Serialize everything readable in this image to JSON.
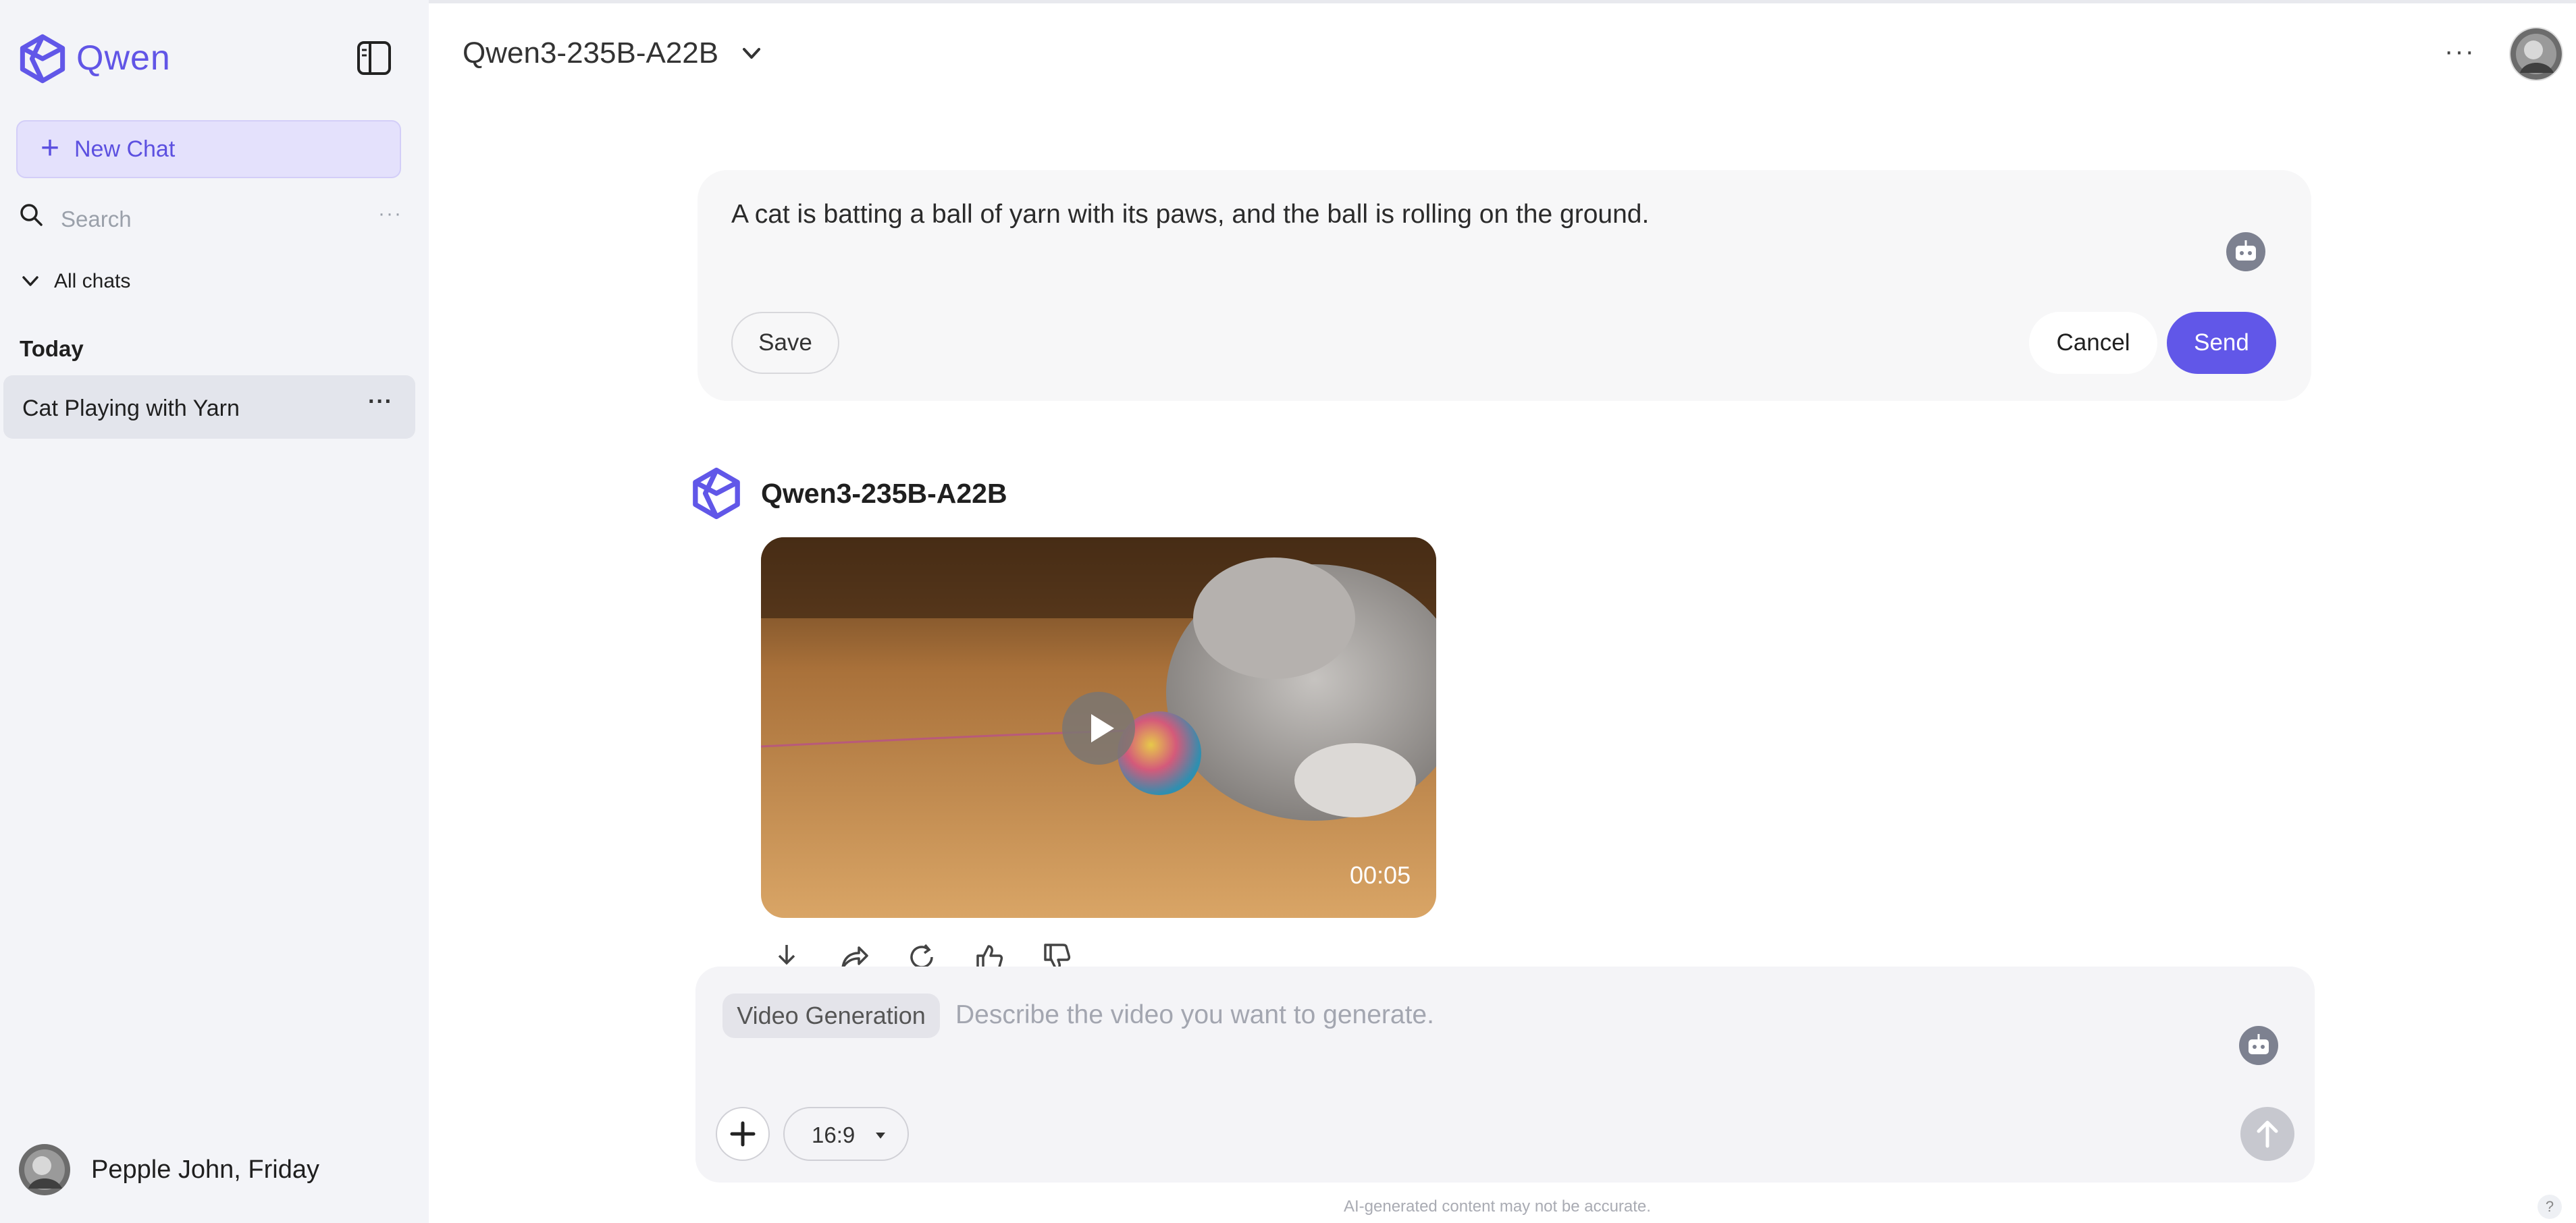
{
  "brand": {
    "name": "Qwen",
    "accent": "#6157e8"
  },
  "sidebar": {
    "new_chat_label": "New Chat",
    "search_placeholder": "Search",
    "all_chats_label": "All chats",
    "section_today": "Today",
    "chats": [
      {
        "title": "Cat Playing with Yarn"
      }
    ],
    "user_name": "Pepple John, Friday"
  },
  "header": {
    "model_name": "Qwen3-235B-A22B"
  },
  "edit_card": {
    "text": "A cat is batting a ball of yarn with its paws, and the ball is rolling on the ground.",
    "save_label": "Save",
    "cancel_label": "Cancel",
    "send_label": "Send"
  },
  "reply": {
    "model_name": "Qwen3-235B-A22B",
    "video_duration": "00:05",
    "actions": [
      "download-icon",
      "share-icon",
      "regenerate-icon",
      "thumbs-up-icon",
      "thumbs-down-icon"
    ]
  },
  "composer": {
    "mode_chip": "Video Generation",
    "placeholder": "Describe the video you want to generate.",
    "aspect_ratio": "16:9"
  },
  "footer": {
    "disclaimer": "AI-generated content may not be accurate.",
    "help": "?"
  }
}
